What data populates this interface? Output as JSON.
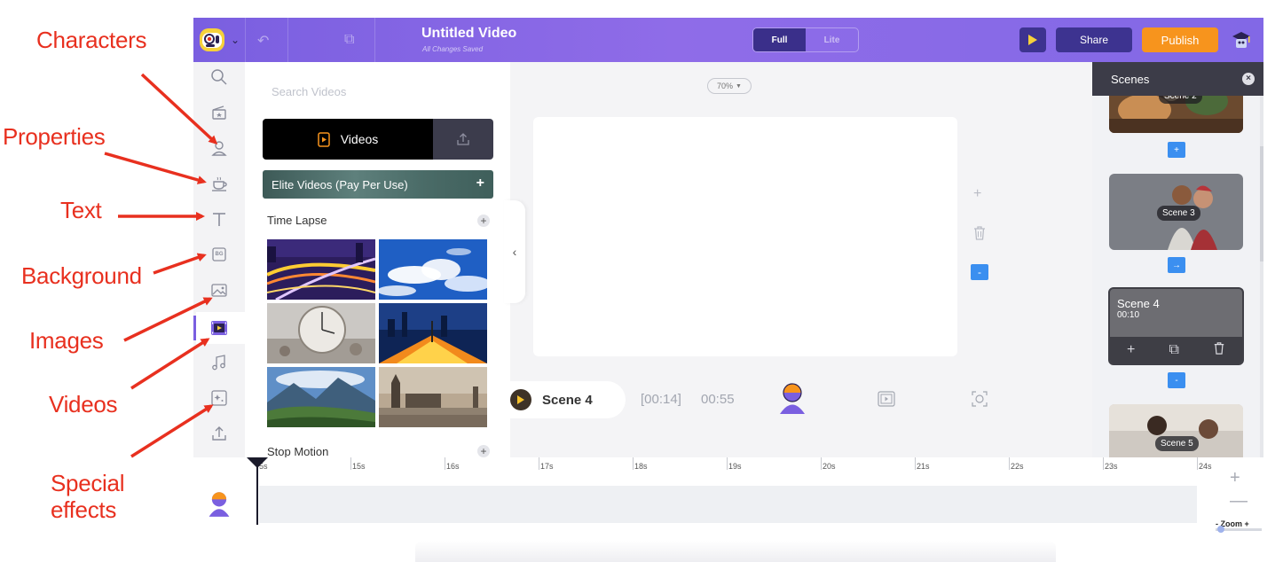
{
  "annotations": {
    "characters": "Characters",
    "properties": "Properties",
    "text": "Text",
    "background": "Background",
    "images": "Images",
    "videos": "Videos",
    "special_effects_line1": "Special",
    "special_effects_line2": "effects"
  },
  "topbar": {
    "title": "Untitled Video",
    "subtitle": "All Changes Saved",
    "mode_full": "Full",
    "mode_lite": "Lite",
    "mode_selected": "Full",
    "share_label": "Share",
    "publish_label": "Publish",
    "accent_color": "#8567e6",
    "publish_color": "#f7941d"
  },
  "tools": {
    "active": "videos",
    "bg_badge": "BG",
    "items": [
      "search",
      "scene",
      "characters",
      "properties",
      "text",
      "background",
      "images",
      "videos",
      "music",
      "effects",
      "upload"
    ]
  },
  "library": {
    "search_placeholder": "Search Videos",
    "videos_tab": "Videos",
    "elite_label": "Elite Videos (Pay Per Use)",
    "elite_plus": "+",
    "sections": [
      {
        "title": "Time Lapse",
        "plus": "+"
      },
      {
        "title": "Stop Motion",
        "plus": "+"
      }
    ]
  },
  "stage": {
    "zoom_level": "70%",
    "scene_name": "Scene 4",
    "time_elapsed": "[00:14]",
    "time_total": "00:55",
    "minus": "-"
  },
  "scenes_panel": {
    "header": "Scenes",
    "close": "×",
    "cards": [
      {
        "label": "Scene 2"
      },
      {
        "label": "Scene 3"
      },
      {
        "label": "Scene 4",
        "duration": "00:10",
        "selected": true
      },
      {
        "label": "Scene 5"
      }
    ],
    "add_plus": "+",
    "add_arrow": "→",
    "remove": "-"
  },
  "timeline": {
    "ticks": [
      "5s",
      "15s",
      "16s",
      "17s",
      "18s",
      "19s",
      "20s",
      "21s",
      "22s",
      "23s",
      "24s"
    ],
    "zoom_label": "-  Zoom  +",
    "zoom_in": "+",
    "zoom_out": "—"
  }
}
